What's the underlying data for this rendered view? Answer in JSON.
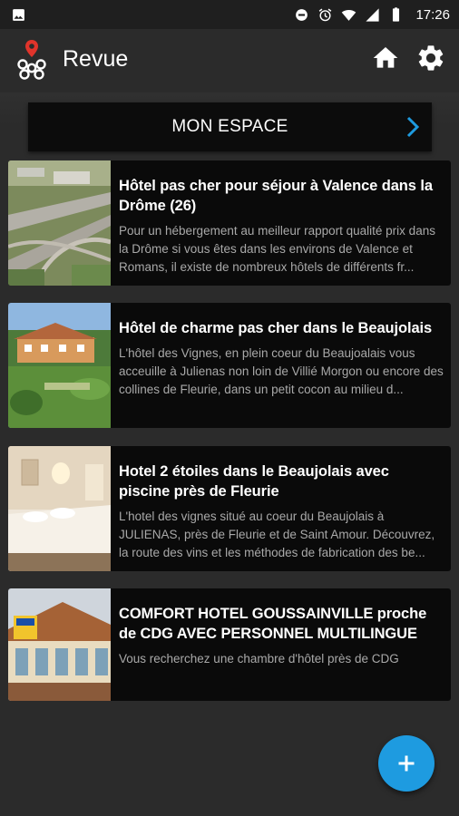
{
  "status_bar": {
    "time": "17:26",
    "icons": [
      "image-icon",
      "dnd-icon",
      "alarm-icon",
      "wifi-icon",
      "signal-icon",
      "battery-icon"
    ]
  },
  "app_bar": {
    "title": "Revue",
    "logo_icon": "app-logo-icon",
    "home_icon": "home-icon",
    "settings_icon": "gear-icon"
  },
  "espace": {
    "label": "MON ESPACE",
    "chevron_icon": "chevron-right-icon",
    "chevron_color": "#1e9be0"
  },
  "articles": [
    {
      "title": "Hôtel pas cher pour séjour à Valence dans la Drôme (26)",
      "description": "Pour un hébergement au meilleur rapport qualité prix dans la Drôme si vous êtes dans les environs de Valence et Romans, il existe de nombreux hôtels de différents fr...",
      "thumbnail": "aerial-highway-photo"
    },
    {
      "title": "Hôtel de charme pas cher dans le Beaujolais",
      "description": "L'hôtel des Vignes, en plein coeur du Beaujoalais vous acceuille à Julienas non loin de Villié Morgon ou encore des collines de Fleurie, dans un petit cocon au milieu d...",
      "thumbnail": "hotel-garden-photo"
    },
    {
      "title": "Hotel 2 étoiles dans le Beaujolais avec piscine près de Fleurie",
      "description": "L'hotel des vignes situé au coeur du Beaujolais à JULIENAS, près de Fleurie et de Saint Amour. Découvrez, la route des vins et les méthodes de fabrication des be...",
      "thumbnail": "hotel-bedroom-photo"
    },
    {
      "title": "COMFORT HOTEL GOUSSAINVILLE proche de  CDG AVEC PERSONNEL MULTILINGUE",
      "description": "Vous recherchez une chambre d'hôtel près de CDG",
      "thumbnail": "hotel-facade-photo"
    }
  ],
  "fab": {
    "icon": "plus-icon",
    "color": "#1e9be0"
  }
}
